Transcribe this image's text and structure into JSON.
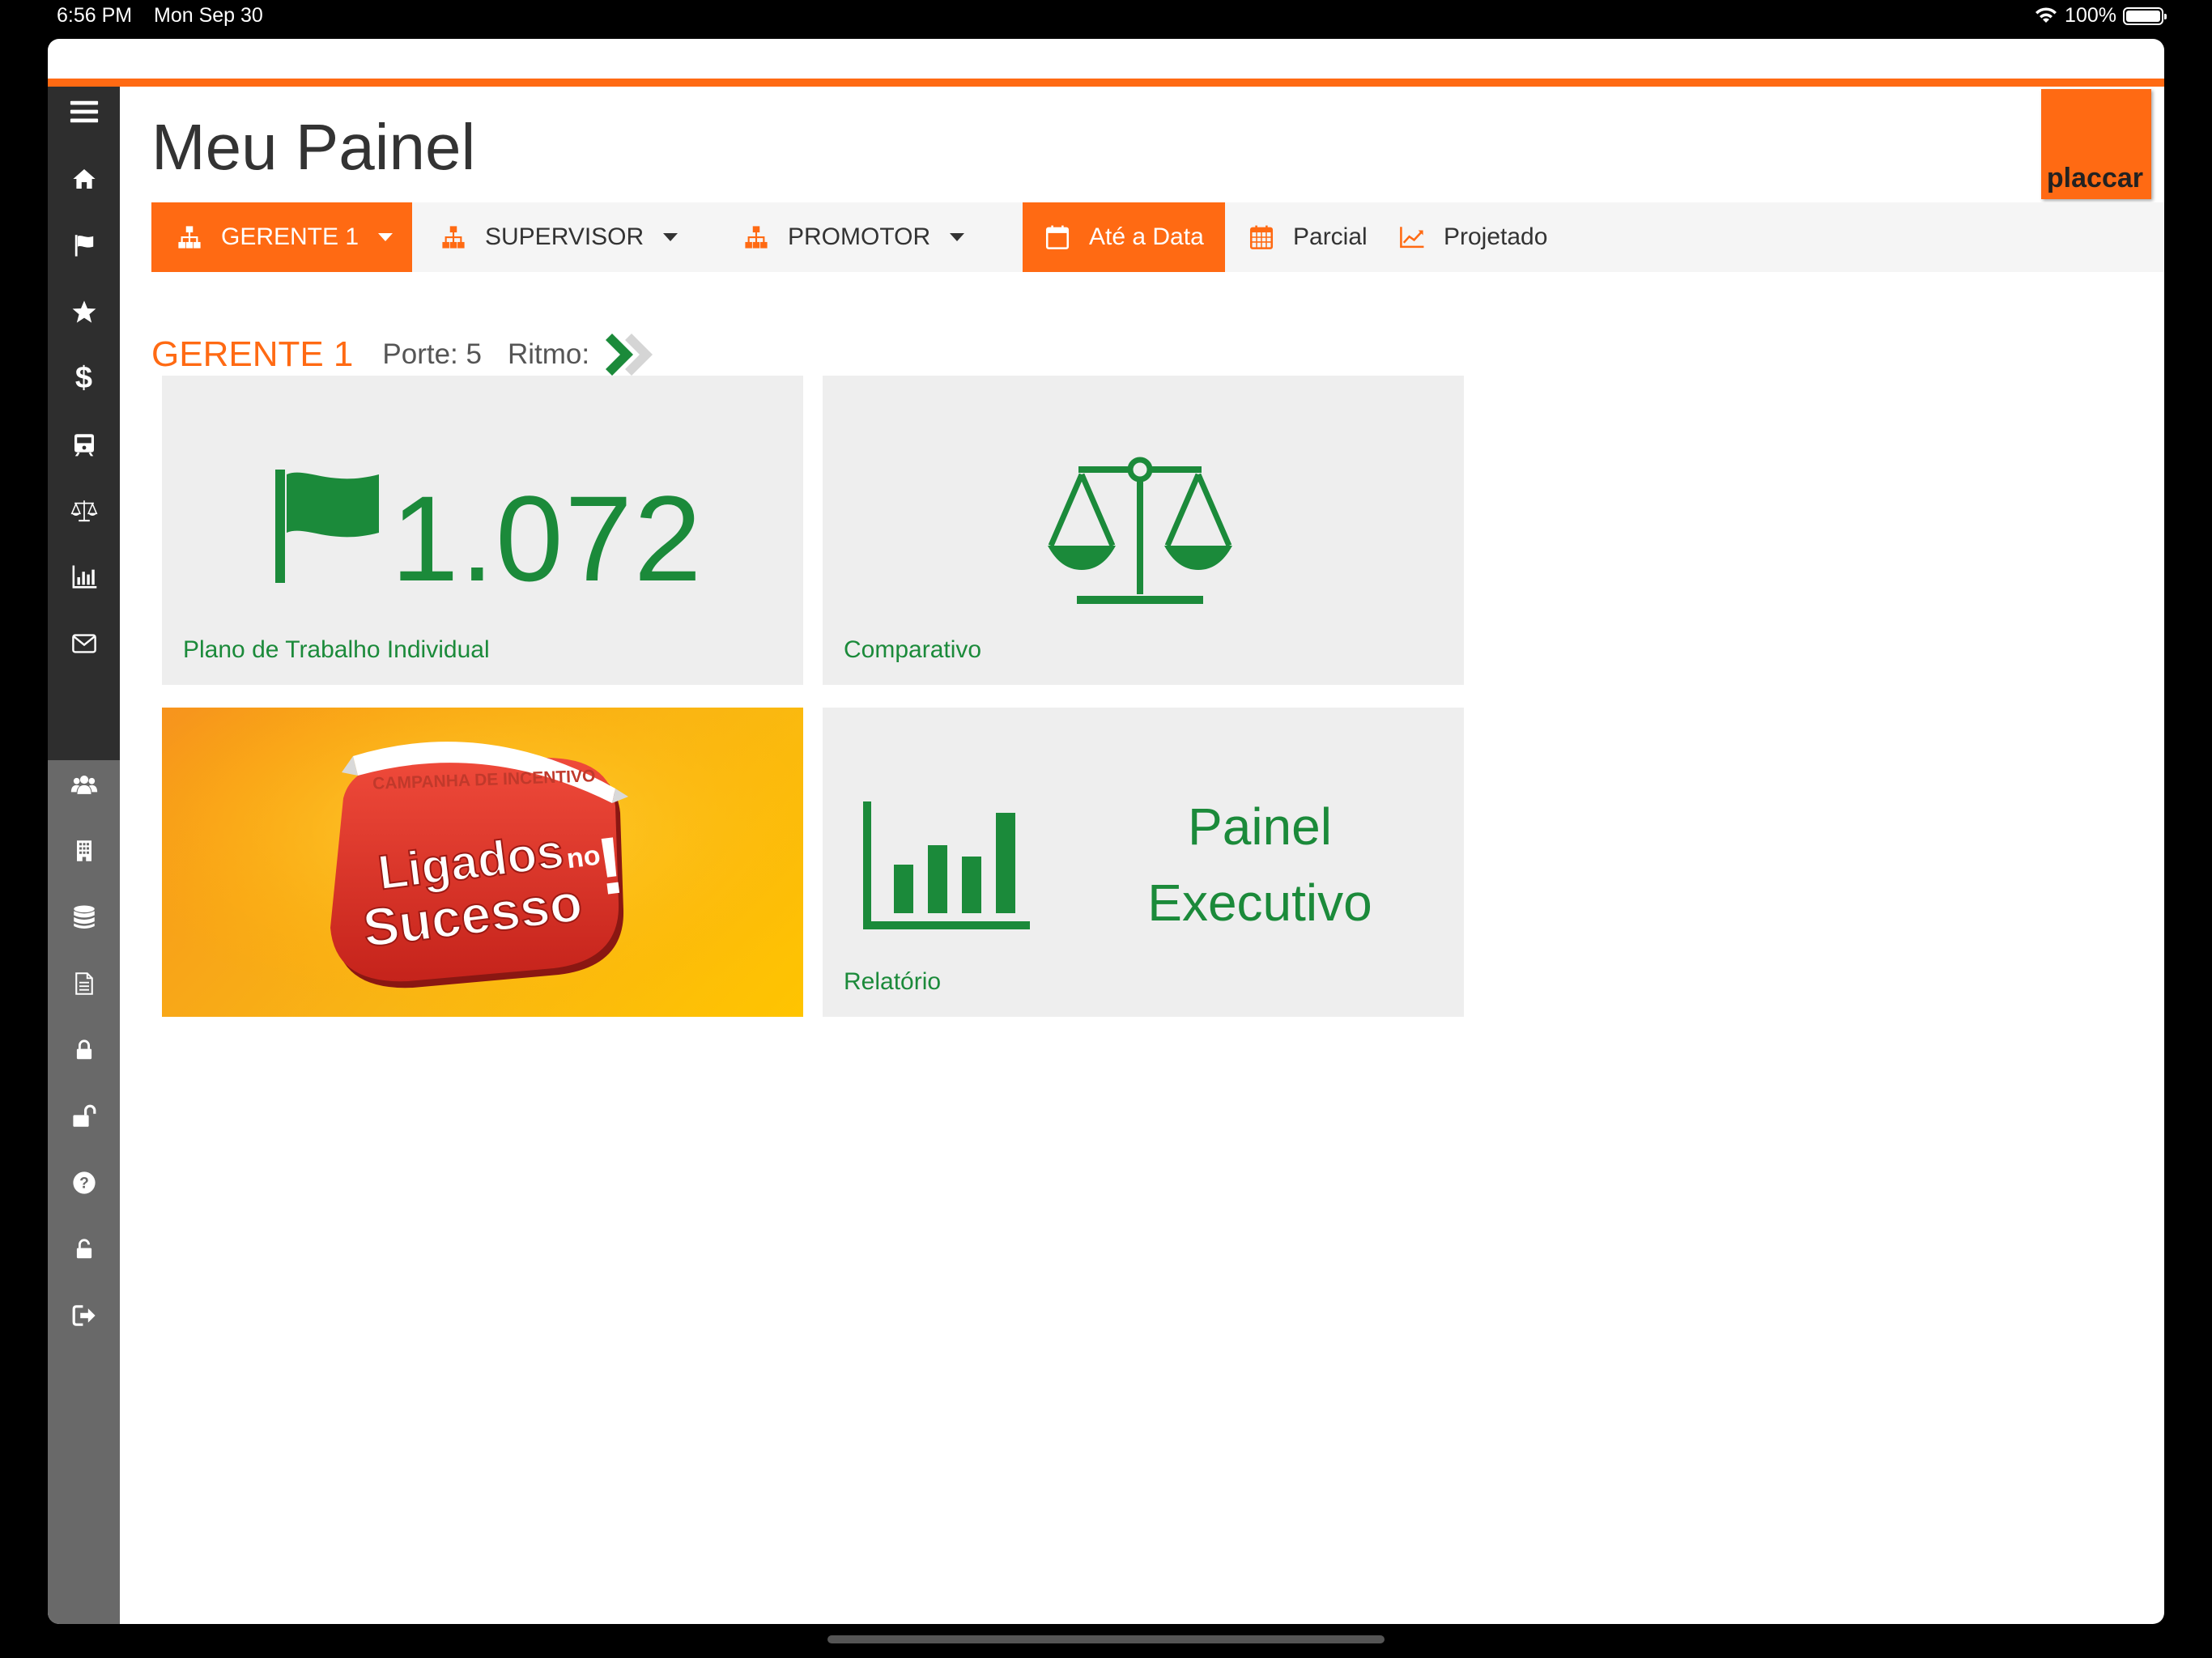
{
  "status_bar": {
    "time": "6:56 PM",
    "date": "Mon Sep 30",
    "battery": "100%"
  },
  "header": {
    "title": "Meu Painel",
    "logo_text": "placcar"
  },
  "toolbar": {
    "gerente": "GERENTE 1",
    "supervisor": "SUPERVISOR",
    "promotor": "PROMOTOR",
    "ate_a_data": "Até a Data",
    "parcial": "Parcial",
    "projetado": "Projetado"
  },
  "info": {
    "name": "GERENTE 1",
    "porte": "Porte: 5",
    "ritmo": "Ritmo:"
  },
  "tiles": {
    "plano": {
      "value": "1.072",
      "label": "Plano de Trabalho Individual"
    },
    "comparativo": {
      "label": "Comparativo"
    },
    "campanha": {
      "ribbon": "CAMPANHA DE INCENTIVO",
      "line1": "Ligados",
      "no": "no",
      "line2": "Sucesso",
      "excl": "!"
    },
    "relatorio": {
      "title_line1": "Painel",
      "title_line2": "Executivo",
      "label": "Relatório"
    }
  },
  "sidebar_icons": [
    "menu-icon",
    "home-icon",
    "flag-icon",
    "star-icon",
    "dollar-icon",
    "train-icon",
    "balance-scale-icon",
    "bar-chart-icon",
    "envelope-icon",
    "users-icon",
    "building-icon",
    "database-icon",
    "document-icon",
    "lock-icon",
    "unlock-icon",
    "question-icon",
    "unlock-alt-icon",
    "sign-out-icon"
  ],
  "colors": {
    "accent": "#ff6a13",
    "green": "#1b8a3a",
    "sidebar_dark": "#2e2e2e",
    "sidebar_gray": "#696969"
  }
}
